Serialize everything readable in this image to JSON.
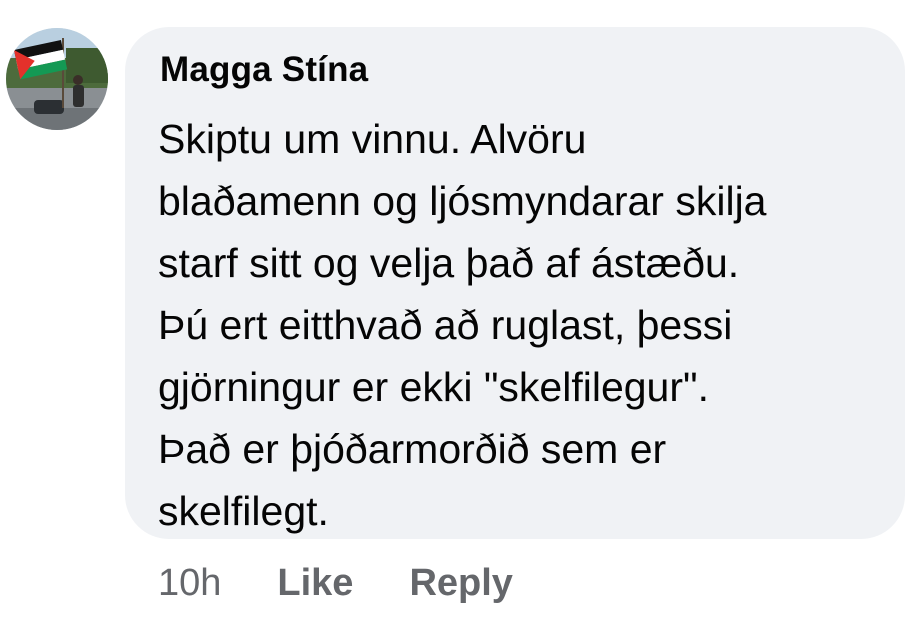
{
  "comment": {
    "author": "Magga Stína",
    "lines": [
      "Skiptu um vinnu. Alvöru",
      "blaðamenn og ljósmyndarar skilja",
      "starf sitt og velja það af ástæðu.",
      "Þú ert eitthvað að ruglast, þessi",
      "gjörningur er ekki \"skelfilegur\".",
      "Það er þjóðarmorðið sem er",
      "skelfilegt."
    ],
    "timestamp": "10h",
    "like_label": "Like",
    "reply_label": "Reply"
  },
  "avatar": {
    "icon": "profile-photo-with-palestine-flag"
  },
  "colors": {
    "bubble_bg": "#f0f2f5",
    "text": "#050505",
    "meta": "#65676b"
  }
}
